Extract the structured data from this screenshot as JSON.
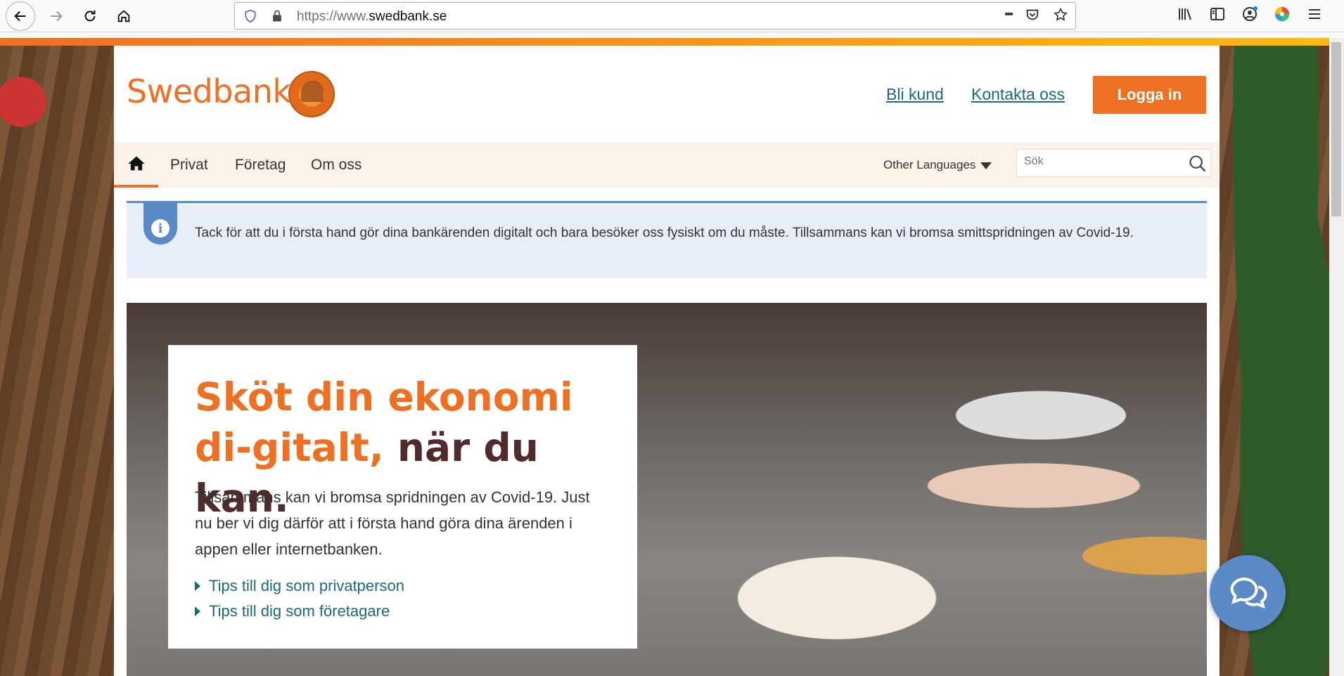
{
  "browser": {
    "url_prefix": "https://www.",
    "url_domain": "swedbank.se",
    "more_label": "•••"
  },
  "header": {
    "logo_text": "Swedbank",
    "links": [
      "Bli kund",
      "Kontakta oss"
    ],
    "login_label": "Logga in"
  },
  "menu": {
    "items": [
      "Privat",
      "Företag",
      "Om oss"
    ],
    "languages_label": "Other Languages",
    "search_placeholder": "Sök"
  },
  "alert": {
    "icon_label": "i",
    "text": "Tack för att du i första hand gör dina bankärenden digitalt och bara besöker oss fysiskt om du måste. Tillsammans kan vi bromsa smittspridningen av Covid-19."
  },
  "hero": {
    "title_orange": "Sköt din ekonomi di-gitalt,",
    "title_dark": "när du kan.",
    "body": "Tillsammans kan vi bromsa spridningen av Covid-19. Just nu ber vi dig därför att i första hand göra dina ärenden i appen eller internetbanken.",
    "links": [
      "Tips till dig som privatperson",
      "Tips till dig som företagare"
    ]
  },
  "colors": {
    "brand_orange": "#ee7023",
    "link_teal": "#1a6a7a",
    "alert_blue": "#5b8ac9",
    "title_dark": "#512b2b"
  }
}
